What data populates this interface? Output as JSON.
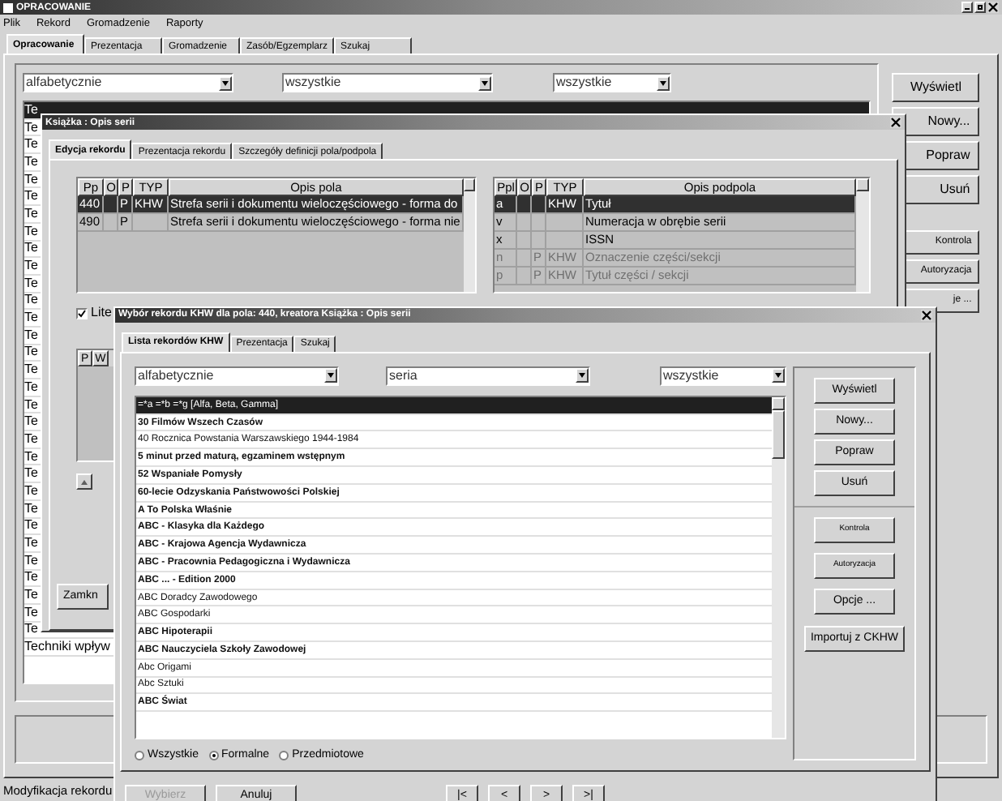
{
  "main_window": {
    "title": "OPRACOWANIE",
    "menu": [
      "Plik",
      "Rekord",
      "Gromadzenie",
      "Raporty"
    ],
    "tabs": [
      {
        "label": "Opracowanie",
        "selected": true
      },
      {
        "label": "Prezentacja",
        "selected": false
      },
      {
        "label": "Gromadzenie",
        "selected": false
      },
      {
        "label": "Zasób/Egzemplarz",
        "selected": false
      },
      {
        "label": "Szukaj",
        "selected": false
      }
    ],
    "filters": [
      "alfabetycznie",
      "wszystkie",
      "wszystkie"
    ],
    "list_rows": [
      {
        "text": "Te",
        "selected": true
      },
      {
        "text": "Te",
        "selected": false
      },
      {
        "text": "Te",
        "selected": false
      },
      {
        "text": "Te",
        "selected": false
      },
      {
        "text": "Te",
        "selected": false
      },
      {
        "text": "Te",
        "selected": false
      },
      {
        "text": "Te",
        "selected": false
      },
      {
        "text": "Te",
        "selected": false
      },
      {
        "text": "Te",
        "selected": false
      },
      {
        "text": "Te",
        "selected": false
      },
      {
        "text": "Te",
        "selected": false
      },
      {
        "text": "Te",
        "selected": false
      },
      {
        "text": "Te",
        "selected": false
      },
      {
        "text": "Te",
        "selected": false
      },
      {
        "text": "Te",
        "selected": false
      },
      {
        "text": "Te",
        "selected": false
      },
      {
        "text": "Te",
        "selected": false
      },
      {
        "text": "Te",
        "selected": false
      },
      {
        "text": "Te",
        "selected": false
      },
      {
        "text": "Te",
        "selected": false
      },
      {
        "text": "Te",
        "selected": false
      },
      {
        "text": "Te",
        "selected": false
      },
      {
        "text": "Te",
        "selected": false
      },
      {
        "text": "Te",
        "selected": false
      },
      {
        "text": "Te",
        "selected": false
      },
      {
        "text": "Te",
        "selected": false
      },
      {
        "text": "Te",
        "selected": false
      },
      {
        "text": "Te",
        "selected": false
      },
      {
        "text": "Te",
        "selected": false
      },
      {
        "text": "Te",
        "selected": false
      },
      {
        "text": "Te",
        "selected": false
      },
      {
        "text": "Techniki wpływ",
        "selected": false
      }
    ],
    "buttons": [
      "Wyświetl",
      "Nowy...",
      "Popraw",
      "Usuń"
    ],
    "small_buttons": [
      "Kontrola",
      "Autoryzacja",
      "je ..."
    ],
    "status_bar": "Modyfikacja rekordu"
  },
  "record_window": {
    "title": "Książka : Opis serii",
    "tabs": [
      {
        "label": "Edycja rekordu",
        "selected": true
      },
      {
        "label": "Prezentacja rekordu",
        "selected": false
      },
      {
        "label": "Szczegóły definicji pola/podpola",
        "selected": false
      }
    ],
    "fields_table": {
      "columns": [
        "Pp",
        "O",
        "P",
        "TYP",
        "Opis pola"
      ],
      "rows": [
        {
          "cells": [
            "440",
            "",
            "P",
            "KHW",
            "Strefa serii i dokumentu wieloczęściowego - forma do"
          ],
          "selected": true
        },
        {
          "cells": [
            "490",
            "",
            "P",
            "",
            "Strefa serii i dokumentu wieloczęściowego - forma nie"
          ],
          "selected": false
        }
      ]
    },
    "subfields_table": {
      "columns": [
        "Ppl",
        "O",
        "P",
        "TYP",
        "Opis podpola"
      ],
      "rows": [
        {
          "cells": [
            "a",
            "",
            "",
            "KHW",
            "Tytuł"
          ],
          "selected": true,
          "disabled": false
        },
        {
          "cells": [
            "v",
            "",
            "",
            "",
            "Numeracja w obrębie serii"
          ],
          "selected": false,
          "disabled": false
        },
        {
          "cells": [
            "x",
            "",
            "",
            "",
            "ISSN"
          ],
          "selected": false,
          "disabled": false
        },
        {
          "cells": [
            "n",
            "",
            "P",
            "KHW",
            "Oznaczenie części/sekcji"
          ],
          "selected": false,
          "disabled": true
        },
        {
          "cells": [
            "p",
            "",
            "P",
            "KHW",
            "Tytuł części / sekcji"
          ],
          "selected": false,
          "disabled": true
        }
      ]
    },
    "checkbox": {
      "label": "Lite",
      "checked": true
    },
    "lower_table": {
      "columns": [
        "P",
        "W"
      ]
    },
    "close_button": "Zamkn"
  },
  "picker_window": {
    "title": "Wybór rekordu KHW dla pola: 440, kreatora Książka : Opis serii",
    "tabs": [
      {
        "label": "Lista rekordów KHW",
        "selected": true
      },
      {
        "label": "Prezentacja",
        "selected": false
      },
      {
        "label": "Szukaj",
        "selected": false
      }
    ],
    "filters": [
      "alfabetycznie",
      "seria",
      "wszystkie"
    ],
    "list_rows": [
      {
        "text": "=*a =*b =*g [Alfa, Beta, Gamma]",
        "selected": true,
        "bold": false
      },
      {
        "text": "30 Filmów Wszech Czasów",
        "selected": false,
        "bold": true
      },
      {
        "text": "40 Rocznica Powstania Warszawskiego 1944-1984",
        "selected": false,
        "bold": false
      },
      {
        "text": "5 minut przed maturą, egzaminem wstępnym",
        "selected": false,
        "bold": true
      },
      {
        "text": "52 Wspaniałe Pomysły",
        "selected": false,
        "bold": true
      },
      {
        "text": "60-lecie Odzyskania Państwowości Polskiej",
        "selected": false,
        "bold": true
      },
      {
        "text": "A To Polska Właśnie",
        "selected": false,
        "bold": true
      },
      {
        "text": "ABC - Klasyka dla Każdego",
        "selected": false,
        "bold": true
      },
      {
        "text": "ABC - Krajowa Agencja Wydawnicza",
        "selected": false,
        "bold": true
      },
      {
        "text": "ABC - Pracownia Pedagogiczna i Wydawnicza",
        "selected": false,
        "bold": true
      },
      {
        "text": "ABC ... - Edition 2000",
        "selected": false,
        "bold": true
      },
      {
        "text": "ABC Doradcy Zawodowego",
        "selected": false,
        "bold": false
      },
      {
        "text": "ABC Gospodarki",
        "selected": false,
        "bold": false
      },
      {
        "text": "ABC Hipoterapii",
        "selected": false,
        "bold": true
      },
      {
        "text": "ABC Nauczyciela Szkoły Zawodowej",
        "selected": false,
        "bold": true
      },
      {
        "text": "Abc Origami",
        "selected": false,
        "bold": false
      },
      {
        "text": "Abc Sztuki",
        "selected": false,
        "bold": false
      },
      {
        "text": "ABC Świat",
        "selected": false,
        "bold": true
      }
    ],
    "radios": [
      {
        "label": "Wszystkie",
        "selected": false
      },
      {
        "label": "Formalne",
        "selected": true
      },
      {
        "label": "Przedmiotowe",
        "selected": false
      }
    ],
    "buttons": [
      "Wyświetl",
      "Nowy...",
      "Popraw",
      "Usuń"
    ],
    "small_buttons": [
      "Kontrola",
      "Autoryzacja"
    ],
    "extra_buttons": [
      "Opcje ...",
      "Importuj z CKHW"
    ],
    "footer_buttons": [
      {
        "label": "Wybierz",
        "disabled": true
      },
      {
        "label": "Anuluj",
        "disabled": false
      }
    ],
    "nav_buttons": [
      "|<",
      "<",
      ">",
      ">|"
    ]
  }
}
